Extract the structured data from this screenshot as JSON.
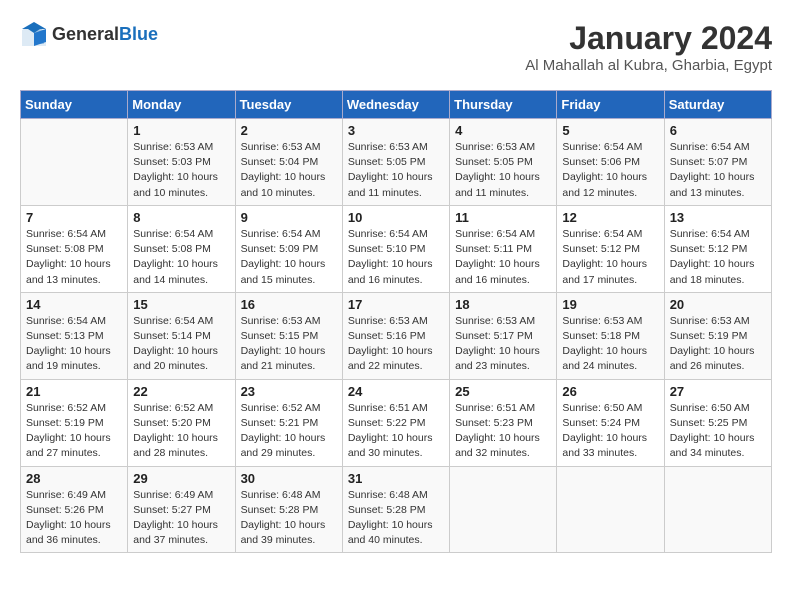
{
  "header": {
    "logo_general": "General",
    "logo_blue": "Blue",
    "month_year": "January 2024",
    "location": "Al Mahallah al Kubra, Gharbia, Egypt"
  },
  "columns": [
    "Sunday",
    "Monday",
    "Tuesday",
    "Wednesday",
    "Thursday",
    "Friday",
    "Saturday"
  ],
  "weeks": [
    [
      {
        "num": "",
        "info": ""
      },
      {
        "num": "1",
        "info": "Sunrise: 6:53 AM\nSunset: 5:03 PM\nDaylight: 10 hours\nand 10 minutes."
      },
      {
        "num": "2",
        "info": "Sunrise: 6:53 AM\nSunset: 5:04 PM\nDaylight: 10 hours\nand 10 minutes."
      },
      {
        "num": "3",
        "info": "Sunrise: 6:53 AM\nSunset: 5:05 PM\nDaylight: 10 hours\nand 11 minutes."
      },
      {
        "num": "4",
        "info": "Sunrise: 6:53 AM\nSunset: 5:05 PM\nDaylight: 10 hours\nand 11 minutes."
      },
      {
        "num": "5",
        "info": "Sunrise: 6:54 AM\nSunset: 5:06 PM\nDaylight: 10 hours\nand 12 minutes."
      },
      {
        "num": "6",
        "info": "Sunrise: 6:54 AM\nSunset: 5:07 PM\nDaylight: 10 hours\nand 13 minutes."
      }
    ],
    [
      {
        "num": "7",
        "info": "Sunrise: 6:54 AM\nSunset: 5:08 PM\nDaylight: 10 hours\nand 13 minutes."
      },
      {
        "num": "8",
        "info": "Sunrise: 6:54 AM\nSunset: 5:08 PM\nDaylight: 10 hours\nand 14 minutes."
      },
      {
        "num": "9",
        "info": "Sunrise: 6:54 AM\nSunset: 5:09 PM\nDaylight: 10 hours\nand 15 minutes."
      },
      {
        "num": "10",
        "info": "Sunrise: 6:54 AM\nSunset: 5:10 PM\nDaylight: 10 hours\nand 16 minutes."
      },
      {
        "num": "11",
        "info": "Sunrise: 6:54 AM\nSunset: 5:11 PM\nDaylight: 10 hours\nand 16 minutes."
      },
      {
        "num": "12",
        "info": "Sunrise: 6:54 AM\nSunset: 5:12 PM\nDaylight: 10 hours\nand 17 minutes."
      },
      {
        "num": "13",
        "info": "Sunrise: 6:54 AM\nSunset: 5:12 PM\nDaylight: 10 hours\nand 18 minutes."
      }
    ],
    [
      {
        "num": "14",
        "info": "Sunrise: 6:54 AM\nSunset: 5:13 PM\nDaylight: 10 hours\nand 19 minutes."
      },
      {
        "num": "15",
        "info": "Sunrise: 6:54 AM\nSunset: 5:14 PM\nDaylight: 10 hours\nand 20 minutes."
      },
      {
        "num": "16",
        "info": "Sunrise: 6:53 AM\nSunset: 5:15 PM\nDaylight: 10 hours\nand 21 minutes."
      },
      {
        "num": "17",
        "info": "Sunrise: 6:53 AM\nSunset: 5:16 PM\nDaylight: 10 hours\nand 22 minutes."
      },
      {
        "num": "18",
        "info": "Sunrise: 6:53 AM\nSunset: 5:17 PM\nDaylight: 10 hours\nand 23 minutes."
      },
      {
        "num": "19",
        "info": "Sunrise: 6:53 AM\nSunset: 5:18 PM\nDaylight: 10 hours\nand 24 minutes."
      },
      {
        "num": "20",
        "info": "Sunrise: 6:53 AM\nSunset: 5:19 PM\nDaylight: 10 hours\nand 26 minutes."
      }
    ],
    [
      {
        "num": "21",
        "info": "Sunrise: 6:52 AM\nSunset: 5:19 PM\nDaylight: 10 hours\nand 27 minutes."
      },
      {
        "num": "22",
        "info": "Sunrise: 6:52 AM\nSunset: 5:20 PM\nDaylight: 10 hours\nand 28 minutes."
      },
      {
        "num": "23",
        "info": "Sunrise: 6:52 AM\nSunset: 5:21 PM\nDaylight: 10 hours\nand 29 minutes."
      },
      {
        "num": "24",
        "info": "Sunrise: 6:51 AM\nSunset: 5:22 PM\nDaylight: 10 hours\nand 30 minutes."
      },
      {
        "num": "25",
        "info": "Sunrise: 6:51 AM\nSunset: 5:23 PM\nDaylight: 10 hours\nand 32 minutes."
      },
      {
        "num": "26",
        "info": "Sunrise: 6:50 AM\nSunset: 5:24 PM\nDaylight: 10 hours\nand 33 minutes."
      },
      {
        "num": "27",
        "info": "Sunrise: 6:50 AM\nSunset: 5:25 PM\nDaylight: 10 hours\nand 34 minutes."
      }
    ],
    [
      {
        "num": "28",
        "info": "Sunrise: 6:49 AM\nSunset: 5:26 PM\nDaylight: 10 hours\nand 36 minutes."
      },
      {
        "num": "29",
        "info": "Sunrise: 6:49 AM\nSunset: 5:27 PM\nDaylight: 10 hours\nand 37 minutes."
      },
      {
        "num": "30",
        "info": "Sunrise: 6:48 AM\nSunset: 5:28 PM\nDaylight: 10 hours\nand 39 minutes."
      },
      {
        "num": "31",
        "info": "Sunrise: 6:48 AM\nSunset: 5:28 PM\nDaylight: 10 hours\nand 40 minutes."
      },
      {
        "num": "",
        "info": ""
      },
      {
        "num": "",
        "info": ""
      },
      {
        "num": "",
        "info": ""
      }
    ]
  ]
}
